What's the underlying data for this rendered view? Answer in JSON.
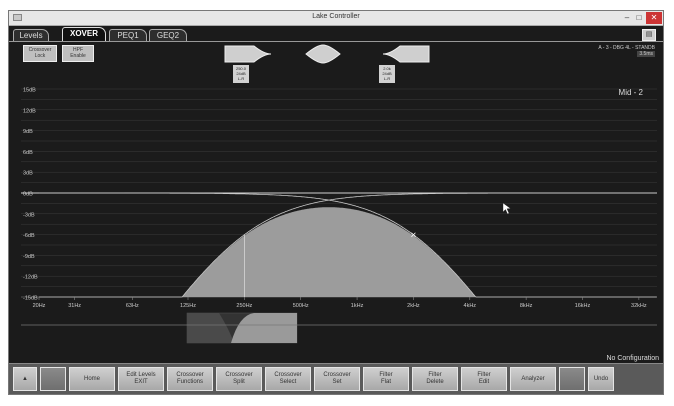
{
  "window": {
    "title": "Lake Controller",
    "minimize": "–",
    "maximize": "□",
    "close": "✕"
  },
  "tabs": [
    {
      "label": "Levels",
      "active": false
    },
    {
      "label": "XOVER",
      "active": true
    },
    {
      "label": "PEQ1",
      "active": false
    },
    {
      "label": "GEQ2",
      "active": false
    }
  ],
  "controls": {
    "xover_lock": {
      "line1": "Crossover",
      "line2": "Lock"
    },
    "hpf_enable": {
      "line1": "HPF",
      "line2": "Enable"
    }
  },
  "filters": {
    "hpf": {
      "line1": "250.0",
      "line2": "24dB",
      "line3": "L-R"
    },
    "lpf": {
      "line1": "2.0k",
      "line2": "24dB",
      "line3": "L-R"
    }
  },
  "module_info": {
    "line1": "A - 3 - DBG 4L - STANDB",
    "line2": "3.5ms"
  },
  "graph": {
    "channel_label": "Mid - 2",
    "y_labels": [
      "15dB",
      "12dB",
      "9dB",
      "6dB",
      "3dB",
      "0dB",
      "-3dB",
      "-6dB",
      "-9dB",
      "-12dB",
      "-15dB"
    ],
    "x_labels": [
      "20Hz",
      "31Hz",
      "63Hz",
      "125Hz",
      "250Hz",
      "500Hz",
      "1kHz",
      "2kHz",
      "4kHz",
      "8kHz",
      "16kHz",
      "32kHz"
    ]
  },
  "chart_data": {
    "type": "area",
    "title": "",
    "xlabel": "",
    "ylabel": "",
    "x_scale": "log",
    "xlim": [
      20,
      40000
    ],
    "ylim": [
      -15,
      15
    ],
    "grid": true,
    "series": [
      {
        "name": "",
        "kind": "highpass",
        "freq_hz": 250,
        "slope_db_oct": 24,
        "type": "L-R"
      },
      {
        "name": "",
        "kind": "lowpass",
        "freq_hz": 2000,
        "slope_db_oct": 24,
        "type": "L-R"
      }
    ],
    "colors": {
      "fill": "#9c9c9c",
      "curve": "#c8c8c8",
      "grid": "#3c3c3c",
      "zero_line": "#d0d0d0"
    }
  },
  "status": {
    "text": "No Configuration"
  },
  "bottom_buttons": [
    {
      "name": "up-button",
      "line1": "▲",
      "line2": "",
      "dim": false
    },
    {
      "name": "blank-button",
      "line1": "",
      "line2": "",
      "dim": true
    },
    {
      "name": "home-button",
      "line1": "Home",
      "line2": "",
      "dim": false
    },
    {
      "name": "edit-levels-exit-button",
      "line1": "Edit Levels",
      "line2": "EXIT",
      "dim": false
    },
    {
      "name": "crossover-functions-button",
      "line1": "Crossover",
      "line2": "Functions",
      "dim": false
    },
    {
      "name": "crossover-split-button",
      "line1": "Crossover",
      "line2": "Split",
      "dim": false
    },
    {
      "name": "crossover-select-button",
      "line1": "Crossover",
      "line2": "Select",
      "dim": false
    },
    {
      "name": "crossover-set-button",
      "line1": "Crossover",
      "line2": "Set",
      "dim": false
    },
    {
      "name": "filter-flat-button",
      "line1": "Filter",
      "line2": "Flat",
      "dim": false
    },
    {
      "name": "filter-delete-button",
      "line1": "Filter",
      "line2": "Delete",
      "dim": false
    },
    {
      "name": "filter-edit-button",
      "line1": "Filter",
      "line2": "Edit",
      "dim": false
    },
    {
      "name": "analyzer-button",
      "line1": "Analyzer",
      "line2": "",
      "dim": false
    },
    {
      "name": "blank-right-button",
      "line1": "",
      "line2": "",
      "dim": true
    },
    {
      "name": "undo-button",
      "line1": "Undo",
      "line2": "",
      "dim": false
    }
  ]
}
